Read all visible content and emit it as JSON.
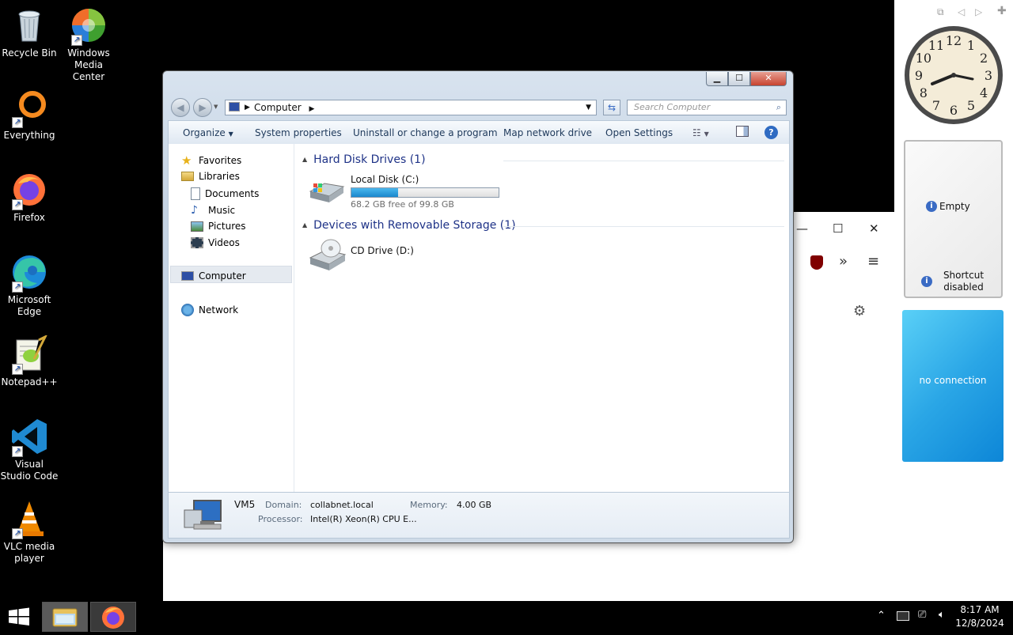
{
  "desktop_icons": [
    {
      "label": "Recycle Bin",
      "icon": "recycle-bin-icon"
    },
    {
      "label": "Windows Media Center",
      "icon": "media-center-icon"
    },
    {
      "label": "Everything",
      "icon": "everything-icon"
    },
    {
      "label": "Firefox",
      "icon": "firefox-icon"
    },
    {
      "label": "Microsoft Edge",
      "icon": "edge-icon"
    },
    {
      "label": "Notepad++",
      "icon": "notepadpp-icon"
    },
    {
      "label": "Visual Studio Code",
      "icon": "vscode-icon"
    },
    {
      "label": "VLC media player",
      "icon": "vlc-icon"
    }
  ],
  "explorer": {
    "address": {
      "crumb": "Computer"
    },
    "search": {
      "placeholder": "Search Computer"
    },
    "toolbar": {
      "organize": "Organize",
      "system_properties": "System properties",
      "uninstall": "Uninstall or change a program",
      "map_drive": "Map network drive",
      "open_settings": "Open Settings"
    },
    "nav": {
      "favorites": "Favorites",
      "libraries": "Libraries",
      "documents": "Documents",
      "music": "Music",
      "pictures": "Pictures",
      "videos": "Videos",
      "computer": "Computer",
      "network": "Network"
    },
    "groups": {
      "hdd": "Hard Disk Drives (1)",
      "removable": "Devices with Removable Storage (1)"
    },
    "drives": {
      "c_name": "Local Disk (C:)",
      "c_free": "68.2 GB free of 99.8 GB",
      "c_used_fraction": 0.317,
      "d_name": "CD Drive (D:)"
    },
    "details": {
      "name": "VM5",
      "domain_label": "Domain:",
      "domain": "collabnet.local",
      "memory_label": "Memory:",
      "memory": "4.00 GB",
      "processor_label": "Processor:",
      "processor": "Intel(R) Xeon(R) CPU E..."
    }
  },
  "gadgets": {
    "clock": {
      "numbers": [
        "12",
        "1",
        "2",
        "3",
        "4",
        "5",
        "6",
        "7",
        "8",
        "9",
        "10",
        "11"
      ]
    },
    "slideshow": {
      "empty": "Empty",
      "shortcut": "Shortcut disabled"
    },
    "weather": {
      "status": "no connection"
    }
  },
  "tray": {
    "time": "8:17 AM",
    "date": "12/8/2024"
  },
  "colors": {
    "accent": "#26a0da",
    "weather_top": "#2fb0e8",
    "weather_bottom": "#0f86d6"
  }
}
